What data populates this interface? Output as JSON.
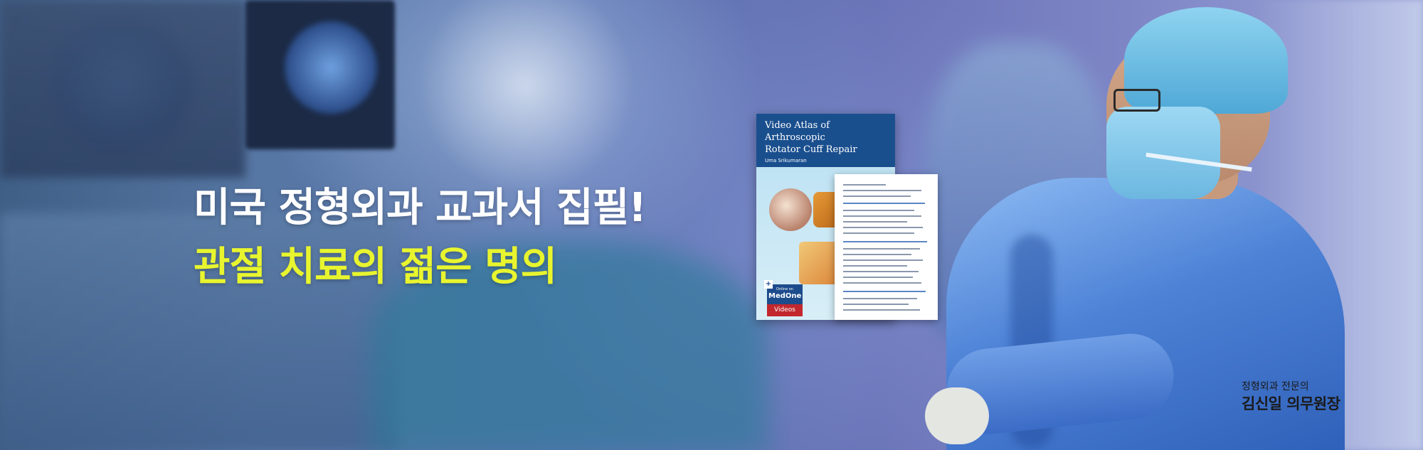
{
  "banner": {
    "headline_line1": "미국 정형외과 교과서 집필!",
    "headline_line2": "관절 치료의 젊은 명의",
    "colors": {
      "headline_white": "#ffffff",
      "headline_yellow": "#e8f52e",
      "book_blue": "#1a4f8e"
    }
  },
  "book": {
    "title": "Video Atlas of Arthroscopic\nRotator Cuff Repair",
    "author": "Uma Srikumaran",
    "badge_top": "Online on",
    "badge_label": "MedOne",
    "badge_sub": "Videos"
  },
  "signature": {
    "subtitle": "정형외과 전문의",
    "name": "김신일 의무원장"
  }
}
